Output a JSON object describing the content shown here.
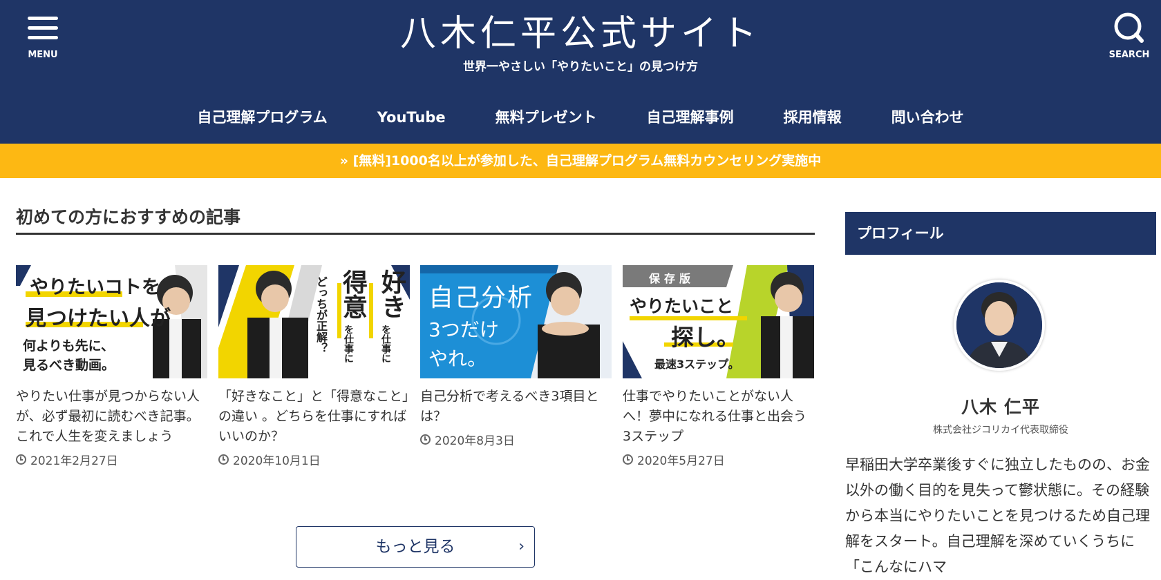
{
  "header": {
    "menu_label": "MENU",
    "search_label": "SEARCH",
    "site_title": "八木仁平公式サイト",
    "tagline": "世界一やさしい「やりたいこと」の見つけ方"
  },
  "nav": [
    {
      "label": "自己理解プログラム"
    },
    {
      "label": "YouTube"
    },
    {
      "label": "無料プレゼント"
    },
    {
      "label": "自己理解事例"
    },
    {
      "label": "採用情報"
    },
    {
      "label": "問い合わせ"
    }
  ],
  "notice": {
    "text": "» [無料]1000名以上が参加した、自己理解プログラム無料カウンセリング実施中"
  },
  "main": {
    "section_title": "初めての方におすすめの記事",
    "more_label": "もっと見る",
    "more_chevron": "›",
    "cards": [
      {
        "title": "やりたい仕事が見つからない人が、必ず最初に読むべき記事。これで人生を変えましょう",
        "date": "2021年2月27日",
        "thumb_text": [
          "やりたいコトを",
          "見つけたい人が",
          "何よりも先に、",
          "見るべき動画。"
        ]
      },
      {
        "title": "「好きなこと」と「得意なこと」の違い 。どちらを仕事にすればいいのか？",
        "date": "2020年10月1日",
        "thumb_text": [
          "好き",
          "を仕事に",
          "得意",
          "を仕事に",
          "どっちが正解？"
        ]
      },
      {
        "title": "自己分析で考えるべき3項目とは？",
        "date": "2020年8月3日",
        "thumb_text": [
          "自己分析",
          "3つだけ",
          "やれ。"
        ]
      },
      {
        "title": "仕事でやりたいことがない人へ！夢中になれる仕事と出会う3ステップ",
        "date": "2020年5月27日",
        "thumb_text": [
          "保存版",
          "やりたいこと",
          "探し。",
          "最速3ステップ。"
        ]
      }
    ]
  },
  "sidebar": {
    "heading": "プロフィール",
    "name": "八木 仁平",
    "role": "株式会社ジコリカイ代表取締役",
    "bio": "早稲田大学卒業後すぐに独立したものの、お金以外の働く目的を見失って鬱状態に。その経験から本当にやりたいことを見つけるため自己理解をスタート。自己理解を深めていくうちに「こんなにハマ"
  },
  "colors": {
    "header_bg": "#1f3566",
    "notice_bg": "#fdb813",
    "accent_yellow": "#f2d500"
  }
}
